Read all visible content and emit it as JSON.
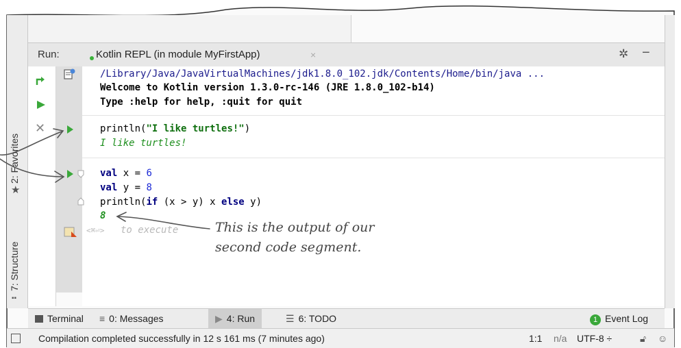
{
  "run_panel": {
    "run_label": "Run:",
    "tab_label": "Kotlin REPL (in module MyFirstApp)",
    "tab_close": "×"
  },
  "console": {
    "lines": [
      "/Library/Java/JavaVirtualMachines/jdk1.8.0_102.jdk/Contents/Home/bin/java ...",
      "Welcome to Kotlin version 1.3.0-rc-146 (JRE 1.8.0_102-b14)",
      "Type :help for help, :quit for quit"
    ],
    "segment1": {
      "input_fn": "println(",
      "input_str": "\"I like turtles!\"",
      "input_end": ")",
      "output": "I like turtles!"
    },
    "segment2": {
      "l1_kw": "val",
      "l1_rest": " x = ",
      "l1_num": "6",
      "l2_kw": "val",
      "l2_rest": " y = ",
      "l2_num": "8",
      "l3_a": "println(",
      "l3_if": "if",
      "l3_b": " (x > y) x ",
      "l3_else": "else",
      "l3_c": " y)",
      "output": "8"
    },
    "execute_hint_keys": "<⌘⏎>",
    "execute_hint_text": "to execute"
  },
  "annotation": {
    "line1": "This is the output of our",
    "line2": "second code segment."
  },
  "side_tabs": {
    "favorites": "2: Favorites",
    "structure": "7: Structure"
  },
  "bottom_tabs": [
    {
      "label": "Terminal"
    },
    {
      "label": "0: Messages"
    },
    {
      "label": "4: Run"
    },
    {
      "label": "6: TODO"
    }
  ],
  "event_log": {
    "badge": "1",
    "label": "Event Log"
  },
  "status": {
    "message": "Compilation completed successfully in 12 s 161 ms (7 minutes ago)",
    "position": "1:1",
    "na": "n/a",
    "encoding": "UTF-8 ÷"
  },
  "colors": {
    "run_triangle": "#3aa83a",
    "string": "#107010",
    "number": "#1d2bd6",
    "keyword": "#000080"
  },
  "icons": [
    "rerun-icon",
    "run-icon",
    "stop-icon",
    "print-icon",
    "gear-icon",
    "minimize-icon",
    "star-icon",
    "structure-icon",
    "terminal-icon",
    "messages-icon",
    "todo-icon",
    "lock-icon",
    "inspector-icon"
  ]
}
